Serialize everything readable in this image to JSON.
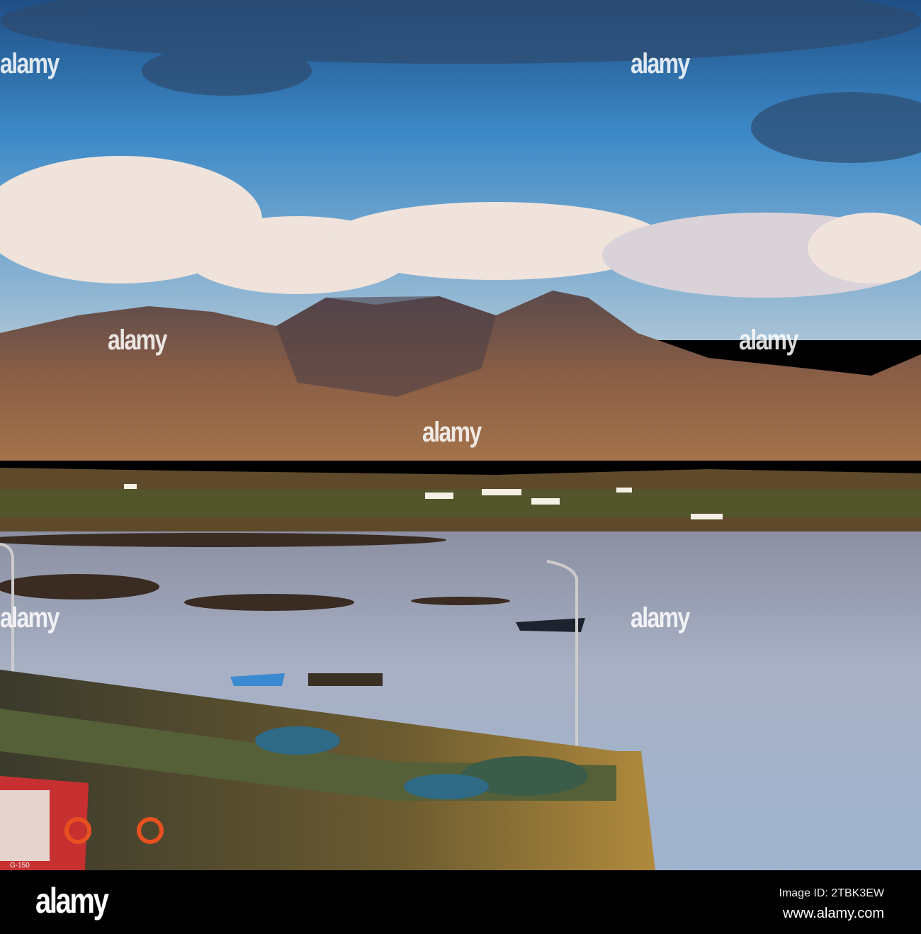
{
  "watermark": "alamy",
  "footer": {
    "logo": "alamy",
    "image_id": "Image ID: 2TBK3EW",
    "url": "www.alamy.com"
  },
  "boat_registration": "G-150"
}
